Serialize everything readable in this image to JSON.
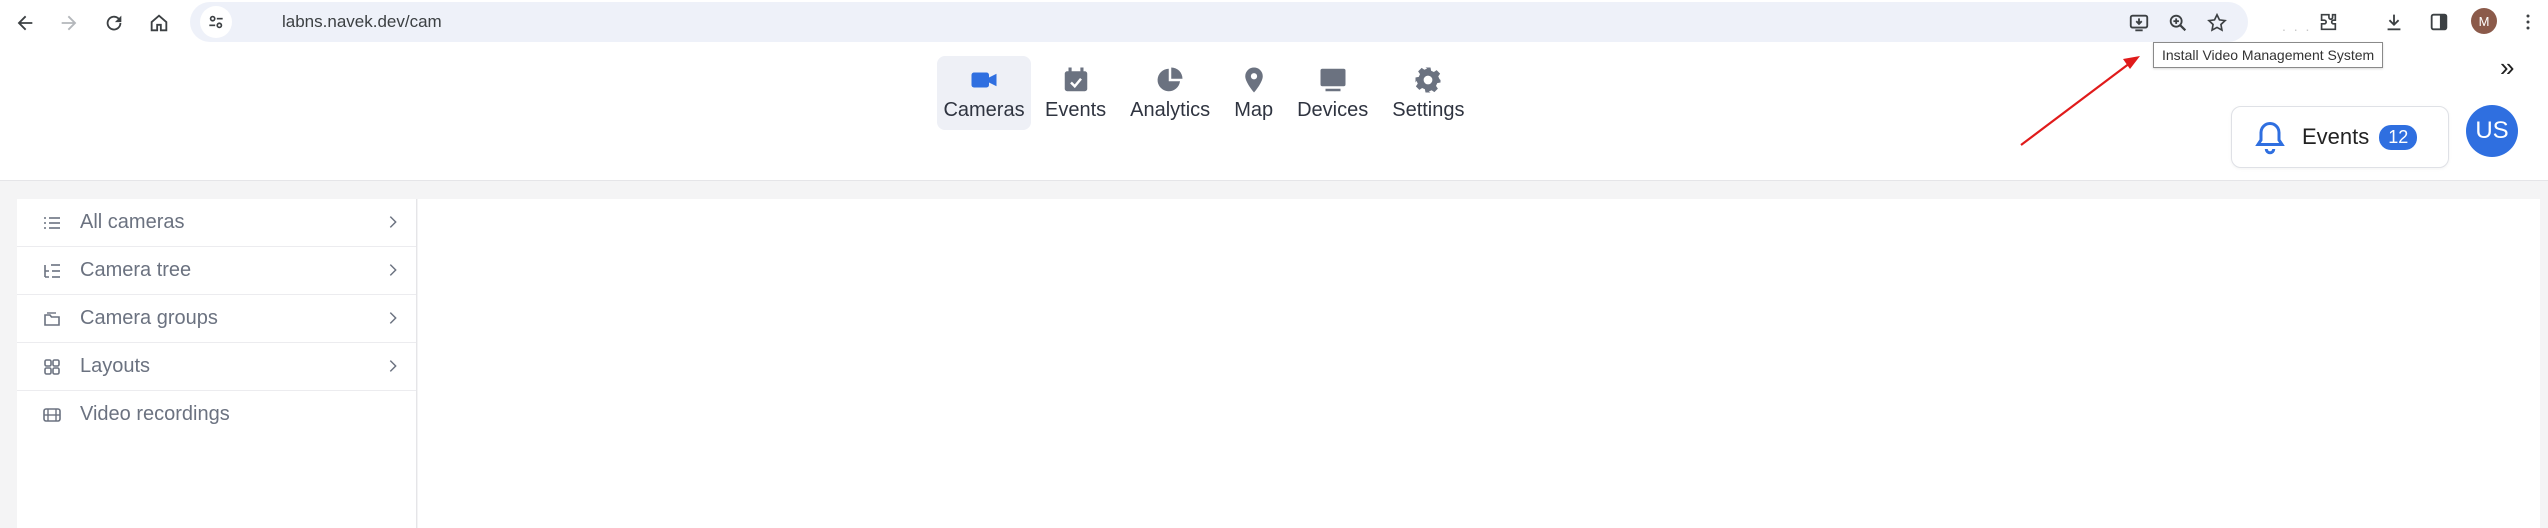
{
  "browser": {
    "url": "labns.navek.dev/cam",
    "tooltip": "Install Video Management System",
    "profile_initial": "M",
    "overflow_label": "»",
    "faint_dots": ". . ."
  },
  "app": {
    "nav": [
      {
        "label": "Cameras",
        "icon": "video-camera-icon",
        "active": true
      },
      {
        "label": "Events",
        "icon": "calendar-check-icon",
        "active": false
      },
      {
        "label": "Analytics",
        "icon": "pie-chart-icon",
        "active": false
      },
      {
        "label": "Map",
        "icon": "map-pin-icon",
        "active": false
      },
      {
        "label": "Devices",
        "icon": "monitor-icon",
        "active": false
      },
      {
        "label": "Settings",
        "icon": "gear-icon",
        "active": false
      }
    ],
    "events_button": {
      "label": "Events",
      "count": "12"
    },
    "avatar": "US"
  },
  "sidebar": {
    "items": [
      {
        "label": "All cameras",
        "icon": "list-icon",
        "has_chevron": true
      },
      {
        "label": "Camera tree",
        "icon": "tree-list-icon",
        "has_chevron": true
      },
      {
        "label": "Camera groups",
        "icon": "folder-icon",
        "has_chevron": true
      },
      {
        "label": "Layouts",
        "icon": "grid-icon",
        "has_chevron": true
      },
      {
        "label": "Video recordings",
        "icon": "film-icon",
        "has_chevron": false
      }
    ]
  },
  "colors": {
    "accent": "#2f6fe0",
    "annotation_arrow": "#e01b1b"
  }
}
